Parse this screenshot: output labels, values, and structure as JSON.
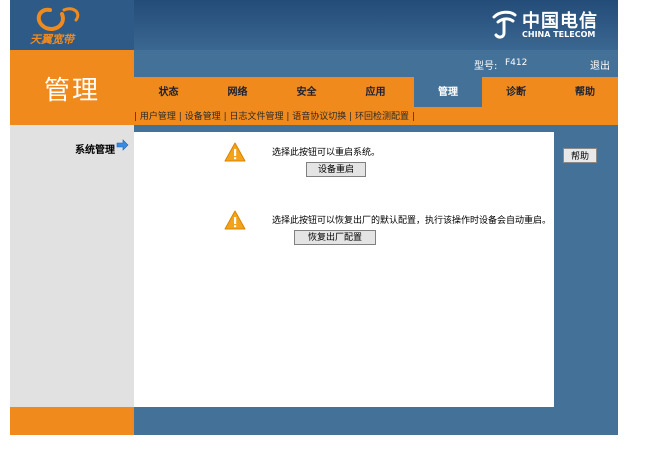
{
  "header": {
    "brand_text": "天翼宽带",
    "telecom_cn": "中国电信",
    "telecom_en": "CHINA TELECOM"
  },
  "page_title": "管理",
  "model": {
    "label": "型号:",
    "value": "F412"
  },
  "logout_label": "退出",
  "tabs": [
    {
      "label": "状态"
    },
    {
      "label": "网络"
    },
    {
      "label": "安全"
    },
    {
      "label": "应用"
    },
    {
      "label": "管理",
      "active": true
    },
    {
      "label": "诊断"
    },
    {
      "label": "帮助"
    }
  ],
  "subnav": [
    "用户管理",
    "设备管理",
    "日志文件管理",
    "语音协议切换",
    "环回检测配置"
  ],
  "sidebar": {
    "item": "系统管理"
  },
  "content": {
    "reboot_message": "选择此按钮可以重启系统。",
    "reboot_button": "设备重启",
    "reset_message": "选择此按钮可以恢复出厂的默认配置，执行该操作时设备会自动重启。",
    "reset_button": "恢复出厂配置"
  },
  "help_button": "帮助",
  "colors": {
    "orange": "#f08a1c",
    "blue": "#447198",
    "dark_blue": "#2e5a87",
    "warning": "#f3a21b"
  }
}
